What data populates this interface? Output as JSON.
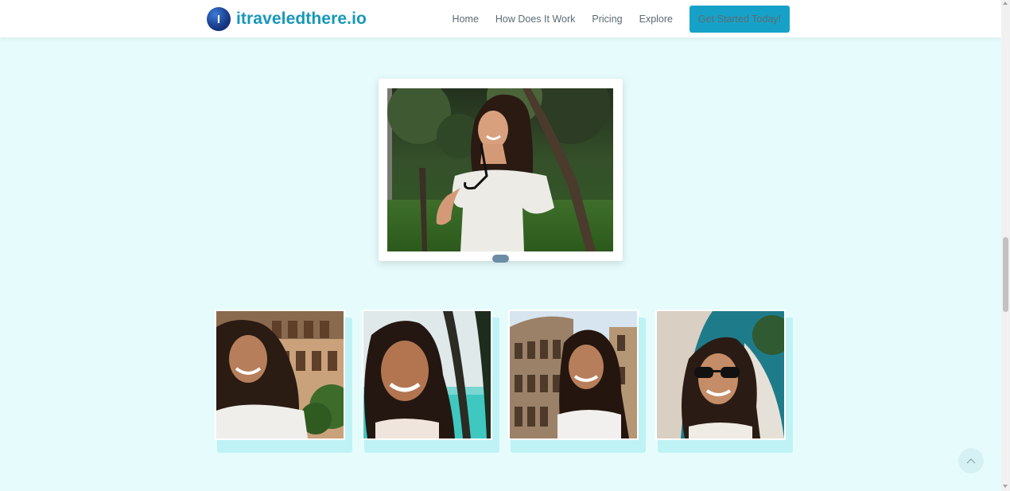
{
  "brand": {
    "logo_letter": "I",
    "name": "itraveledthere.io",
    "color": "#1798b8"
  },
  "nav": {
    "items": [
      {
        "label": "Home"
      },
      {
        "label": "How Does It Work"
      },
      {
        "label": "Pricing"
      },
      {
        "label": "Explore"
      }
    ],
    "cta_label": "Get Started Today!",
    "cta_color": "#16a2c8"
  },
  "feature": {
    "image_icon": "portrait-photo-park",
    "handle_icon": "slider-handle"
  },
  "gallery": {
    "items": [
      {
        "scene": "colosseum-portrait"
      },
      {
        "scene": "beach-palm-portrait"
      },
      {
        "scene": "colosseum-portrait-2"
      },
      {
        "scene": "sunglasses-portrait"
      }
    ]
  },
  "scroll_top": {
    "icon": "chevron-up-icon"
  },
  "colors": {
    "page_bg": "#e6fcfc",
    "card_shadow": "#bff2f5"
  }
}
